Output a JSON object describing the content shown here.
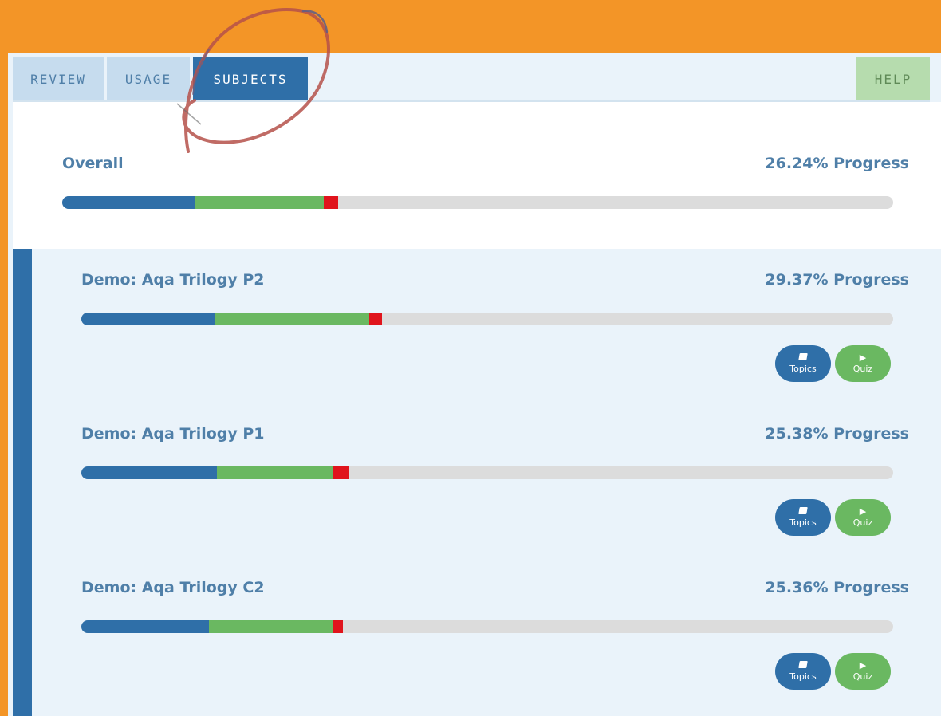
{
  "tabs": [
    {
      "label": "REVIEW"
    },
    {
      "label": "USAGE"
    },
    {
      "label": "SUBJECTS"
    },
    {
      "label": "HELP"
    }
  ],
  "overall": {
    "title": "Overall",
    "progress_text": "26.24% Progress",
    "bar": {
      "blue": 0.16,
      "green": 0.155,
      "red": 0.017
    }
  },
  "subjects": [
    {
      "title": "Demo: Aqa Trilogy P2",
      "progress_text": "29.37% Progress",
      "bar": {
        "blue": 0.165,
        "green": 0.19,
        "red": 0.015
      },
      "topics_label": "Topics",
      "quiz_label": "Quiz"
    },
    {
      "title": "Demo: Aqa Trilogy P1",
      "progress_text": "25.38% Progress",
      "bar": {
        "blue": 0.167,
        "green": 0.142,
        "red": 0.021
      },
      "topics_label": "Topics",
      "quiz_label": "Quiz"
    },
    {
      "title": "Demo: Aqa Trilogy C2",
      "progress_text": "25.36% Progress",
      "bar": {
        "blue": 0.157,
        "green": 0.153,
        "red": 0.012
      },
      "topics_label": "Topics",
      "quiz_label": "Quiz"
    }
  ],
  "icons": {
    "topics": "book-icon",
    "quiz": "play-icon"
  },
  "colors": {
    "header": "#f39527",
    "accent_blue": "#2f6fa8",
    "green": "#6ab861",
    "red": "#e0141c",
    "track": "#dcdcdc",
    "panel": "#eaf3fa",
    "annotation": "#b5514a"
  }
}
